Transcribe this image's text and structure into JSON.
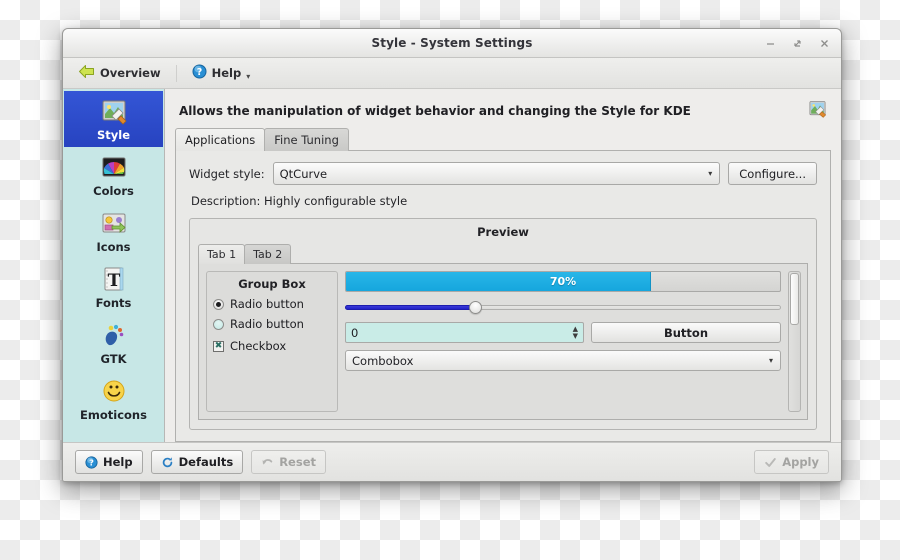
{
  "window": {
    "title": "Style - System Settings",
    "controls": [
      {
        "name": "minimize",
        "glyph": "minimize-icon"
      },
      {
        "name": "maximize",
        "glyph": "maximize-icon"
      },
      {
        "name": "close",
        "glyph": "close-icon"
      }
    ]
  },
  "toolbar": {
    "overview_label": "Overview",
    "overview_icon": "back-arrow-icon",
    "help_label": "Help",
    "help_icon": "help-question-icon",
    "help_caret": "▾"
  },
  "sidebar": {
    "items": [
      {
        "label": "Style",
        "icon": "style-paintbrush-icon",
        "selected": true
      },
      {
        "label": "Colors",
        "icon": "colors-palette-icon",
        "selected": false
      },
      {
        "label": "Icons",
        "icon": "icons-theme-icon",
        "selected": false
      },
      {
        "label": "Fonts",
        "icon": "fonts-letter-t-icon",
        "selected": false
      },
      {
        "label": "GTK",
        "icon": "gtk-foot-icon",
        "selected": false
      },
      {
        "label": "Emoticons",
        "icon": "emoticon-smiley-icon",
        "selected": false
      }
    ]
  },
  "kcm": {
    "description": "Allows the manipulation of widget behavior and changing the Style for KDE",
    "header_icon": "style-paintbrush-icon",
    "tabs": [
      {
        "label": "Applications",
        "active": true
      },
      {
        "label": "Fine Tuning",
        "active": false
      }
    ]
  },
  "style_row": {
    "label": "Widget style:",
    "value": "QtCurve",
    "caret": "▾",
    "configure_label": "Configure...",
    "description": "Description: Highly configurable style"
  },
  "preview": {
    "title": "Preview",
    "tabs": [
      {
        "label": "Tab 1",
        "active": true
      },
      {
        "label": "Tab 2",
        "active": false
      }
    ],
    "groupbox": {
      "title": "Group Box",
      "radio1_label": "Radio button",
      "radio1_checked": true,
      "radio2_label": "Radio button",
      "radio2_checked": false,
      "checkbox_label": "Checkbox",
      "checkbox_checked": true,
      "checkbox_glyph": "✖"
    },
    "progress": {
      "text": "70%",
      "percent": 70
    },
    "slider": {
      "percent": 30
    },
    "spinbox": {
      "value": "0",
      "up_glyph": "▲",
      "down_glyph": "▼"
    },
    "button_label": "Button",
    "combobox": {
      "value": "Combobox",
      "caret": "▾"
    },
    "scrollbar": {
      "handle_position": "top"
    }
  },
  "bottombar": {
    "help_label": "Help",
    "help_icon": "help-question-icon",
    "defaults_label": "Defaults",
    "defaults_icon": "refresh-icon",
    "reset_label": "Reset",
    "reset_icon": "undo-arrow-icon",
    "reset_enabled": false,
    "apply_label": "Apply",
    "apply_icon": "check-icon",
    "apply_enabled": false
  },
  "colors": {
    "sidebar_bg": "#c7e7e6",
    "selection_blue": "#2743c0",
    "progress_cyan": "#16a6dd",
    "slider_blue": "#2222c8",
    "spin_field": "#c9ece7"
  }
}
